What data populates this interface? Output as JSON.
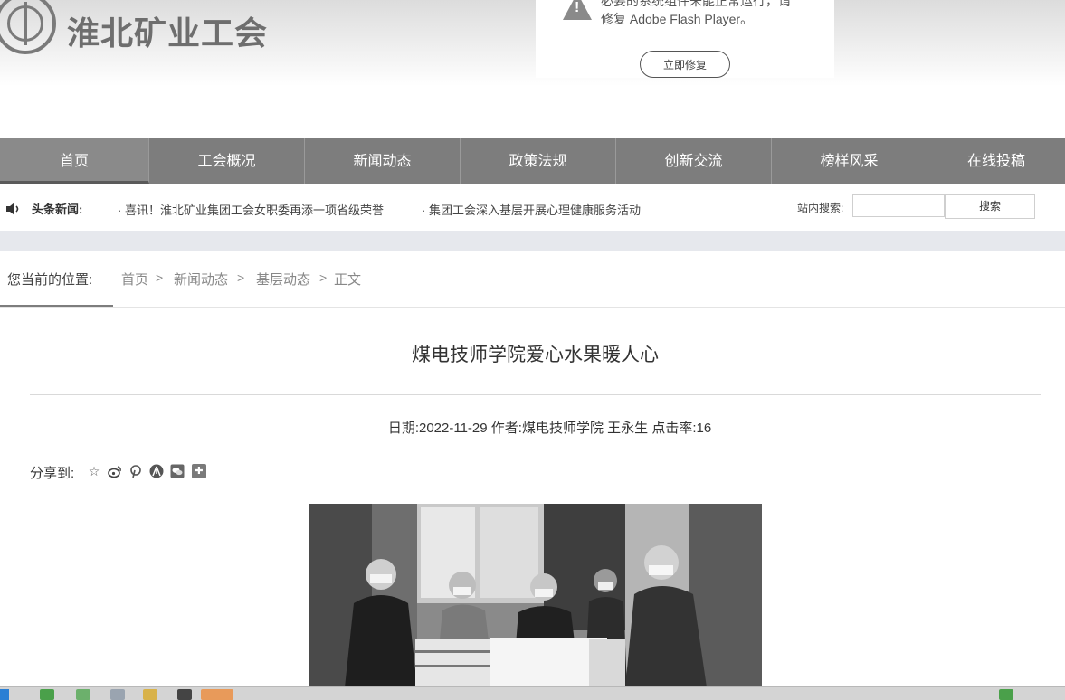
{
  "header": {
    "site_name": "淮北矿业工会",
    "flash_notice": {
      "line1": "必要的系统组件未能正常运行，请",
      "line2": "修复 Adobe Flash Player。",
      "button": "立即修复"
    }
  },
  "nav": {
    "items": [
      {
        "label": "首页"
      },
      {
        "label": "工会概况"
      },
      {
        "label": "新闻动态"
      },
      {
        "label": "政策法规"
      },
      {
        "label": "创新交流"
      },
      {
        "label": "榜样风采"
      },
      {
        "label": "在线投稿"
      }
    ]
  },
  "headline": {
    "label": "头条新闻:",
    "items": [
      "· 喜讯！淮北矿业集团工会女职委再添一项省级荣誉",
      "· 集团工会深入基层开展心理健康服务活动"
    ],
    "search_label": "站内搜索:",
    "search_button": "搜索"
  },
  "breadcrumb": {
    "label": "您当前的位置:",
    "items": [
      "首页",
      "新闻动态",
      "基层动态",
      "正文"
    ],
    "separator": ">"
  },
  "article": {
    "title": "煤电技师学院爱心水果暖人心",
    "date_label": "日期:",
    "date": "2022-11-29",
    "author_label": "作者:",
    "author": "煤电技师学院 王永生",
    "clicks_label": "点击率:",
    "clicks": "16",
    "share_label": "分享到:"
  },
  "share_icons": [
    "favorite-star-icon",
    "weibo-icon",
    "pinterest-icon",
    "renren-icon",
    "wechat-icon",
    "more-plus-icon"
  ],
  "colors": {
    "nav_bg": "#7d7d7d",
    "band": "#e6e8ed"
  }
}
